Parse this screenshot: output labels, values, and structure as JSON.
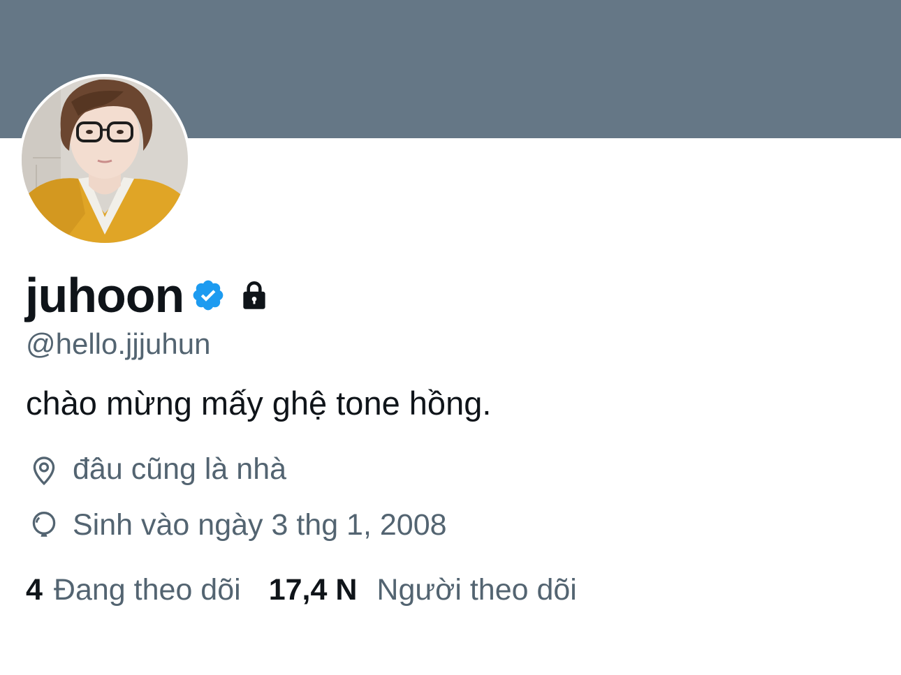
{
  "profile": {
    "display_name": "juhoon",
    "handle": "@hello.jjjuhun",
    "bio": "chào mừng mấy ghệ tone hồng.",
    "verified": true,
    "protected": true,
    "location": "đâu cũng là nhà",
    "birthday": "Sinh vào ngày 3 thg 1, 2008"
  },
  "stats": {
    "following_count": "4",
    "following_label": "Đang theo dõi",
    "followers_count": "17,4 N",
    "followers_label": "Người theo dõi"
  },
  "icons": {
    "verified": "verified-badge-icon",
    "lock": "lock-icon",
    "location": "location-pin-icon",
    "birthday": "balloon-icon"
  },
  "colors": {
    "banner": "#657786",
    "verified_blue": "#1d9bf0",
    "primary_text": "#0f1419",
    "secondary_text": "#536471"
  }
}
